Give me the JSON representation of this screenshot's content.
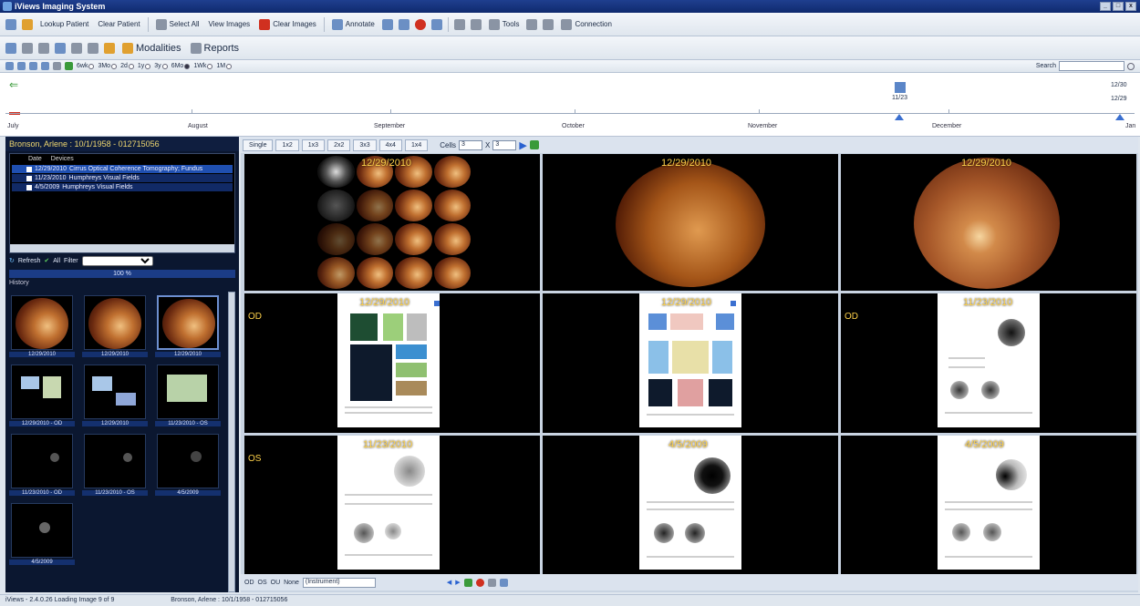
{
  "window": {
    "title": "iViews Imaging System",
    "controls": [
      "_",
      "□",
      "x"
    ]
  },
  "toolbar1": {
    "items": [
      "Lookup Patient",
      "Clear Patient",
      "Select All",
      "View Images",
      "Clear Images",
      "Annotate",
      "Tools",
      "Connection"
    ]
  },
  "toolbar2": {
    "modalities": "Modalities",
    "reports": "Reports"
  },
  "toolbar3": {
    "ranges": [
      "6wk",
      "3Mo",
      "2d",
      "1y",
      "3y",
      "6Mo",
      "1Wk",
      "1M"
    ],
    "selected_range": "6Mo",
    "search_label": "Search",
    "search_value": ""
  },
  "timeline": {
    "months": [
      "July",
      "August",
      "September",
      "October",
      "November",
      "December",
      "Jan"
    ],
    "events": [
      {
        "label1": "11/23",
        "label2": ""
      },
      {
        "label1": "12/30",
        "label2": "12/29"
      }
    ]
  },
  "patient": {
    "header": "Bronson, Arlene : 10/1/1958 - 012715056"
  },
  "studies": {
    "columns": [
      "Date",
      "Devices"
    ],
    "rows": [
      {
        "date": "12/29/2010",
        "device": "Cirrus Optical Coherence Tomography; Fundus"
      },
      {
        "date": "11/23/2010",
        "device": "Humphreys Visual Fields"
      },
      {
        "date": "4/5/2009",
        "device": "Humphreys Visual Fields"
      }
    ]
  },
  "filter": {
    "refresh": "Refresh",
    "all": "All",
    "filter_label": "Filter",
    "filter_value": ""
  },
  "progress": {
    "text": "100 %"
  },
  "history": {
    "label": "History",
    "thumbs": [
      {
        "caption": "12/29/2010"
      },
      {
        "caption": "12/29/2010"
      },
      {
        "caption": "12/29/2010"
      },
      {
        "caption": "12/29/2010 - OD"
      },
      {
        "caption": "12/29/2010"
      },
      {
        "caption": "11/23/2010 - OS"
      },
      {
        "caption": "11/23/2010 - OD"
      },
      {
        "caption": "11/23/2010 - OS"
      },
      {
        "caption": "4/5/2009"
      },
      {
        "caption": "4/5/2009"
      }
    ]
  },
  "viewer": {
    "layouts": [
      "Single",
      "1x2",
      "1x3",
      "2x2",
      "3x3",
      "4x4",
      "1x4"
    ],
    "cells_label": "Cells",
    "cols_value": "3",
    "rows_value": "3",
    "x_sep": "X",
    "cells": [
      {
        "date": "12/29/2010",
        "eye": ""
      },
      {
        "date": "12/29/2010",
        "eye": ""
      },
      {
        "date": "12/29/2010",
        "eye": ""
      },
      {
        "date": "12/29/2010",
        "eye": "OD"
      },
      {
        "date": "12/29/2010",
        "eye": ""
      },
      {
        "date": "11/23/2010",
        "eye": "OD"
      },
      {
        "date": "11/23/2010",
        "eye": "OS"
      },
      {
        "date": "4/5/2009",
        "eye": ""
      },
      {
        "date": "4/5/2009",
        "eye": ""
      }
    ],
    "bottom": {
      "od": "OD",
      "os": "OS",
      "ou": "OU",
      "none": "None",
      "instrument": "(Instrument)"
    }
  },
  "status": {
    "left": "iViews - 2.4.0.26   Loading Image 9 of 9",
    "center": "Bronson, Arlene : 10/1/1958 - 012715056"
  }
}
